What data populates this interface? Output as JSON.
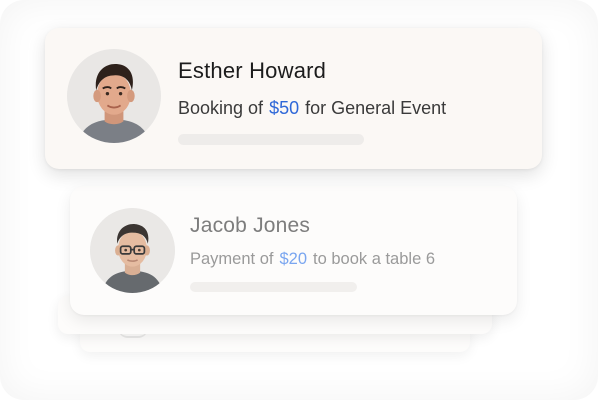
{
  "notifications": [
    {
      "name": "Esther Howard",
      "prefix": "Booking of",
      "amount": "$50",
      "suffix": "for General Event",
      "progress": 0,
      "avatar_icon": "user-avatar-photo"
    },
    {
      "name": "Jacob Jones",
      "prefix": "Payment of",
      "amount": "$20",
      "suffix": "to book a table 6",
      "progress": 0,
      "avatar_icon": "user-avatar-photo"
    }
  ],
  "colors": {
    "amount_primary": "#2f68d8",
    "amount_faded": "#7aa6f0",
    "card_background": "#fbf8f5"
  }
}
